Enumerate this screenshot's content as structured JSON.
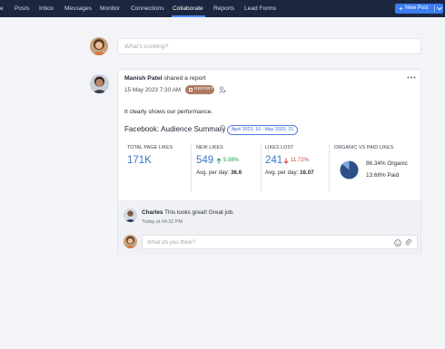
{
  "nav": {
    "items": [
      "e",
      "Posts",
      "Inbox",
      "Messages",
      "Monitor",
      "Connections",
      "Collaborate",
      "Reports",
      "Lead Forms"
    ],
    "active": "Collaborate",
    "new_post_label": "New Post"
  },
  "composer": {
    "placeholder": "What's cooking?"
  },
  "post": {
    "author": "Manish Patel",
    "action": "shared a report",
    "timestamp": "15 May 2023 7:30 AM",
    "badge": "REPORT",
    "caption": "It clearly shows our performance.",
    "report": {
      "title": "Facebook: Audience Summary",
      "date_range": "April 2023, 16 - May 2023, 15",
      "stats": [
        {
          "label": "TOTAL PAGE LIKES",
          "value": "171K"
        },
        {
          "label": "NEW LIKES",
          "value": "549",
          "change": "5.98%",
          "direction": "up",
          "avg_label": "Avg. per day:",
          "avg_value": "36.6"
        },
        {
          "label": "LIKES LOST",
          "value": "241",
          "change": "11.72%",
          "direction": "down",
          "avg_label": "Avg. per day:",
          "avg_value": "16.07"
        },
        {
          "label": "ORGANIC VS PAID LIKES",
          "organic": "86.34% Organic",
          "paid": "13.66% Paid"
        }
      ],
      "organic_fraction": 0.8634
    }
  },
  "comment": {
    "author": "Charles",
    "text": "This looks great! Great job.",
    "time": "Today at 04:32 PM"
  },
  "reply": {
    "placeholder": "What do you think?"
  },
  "colors": {
    "nav_bg": "#1b2640",
    "accent": "#3c7cf0",
    "badge": "#ae7a63",
    "up": "#1f9a44",
    "down": "#d23b3b",
    "stat": "#3d75c9"
  }
}
